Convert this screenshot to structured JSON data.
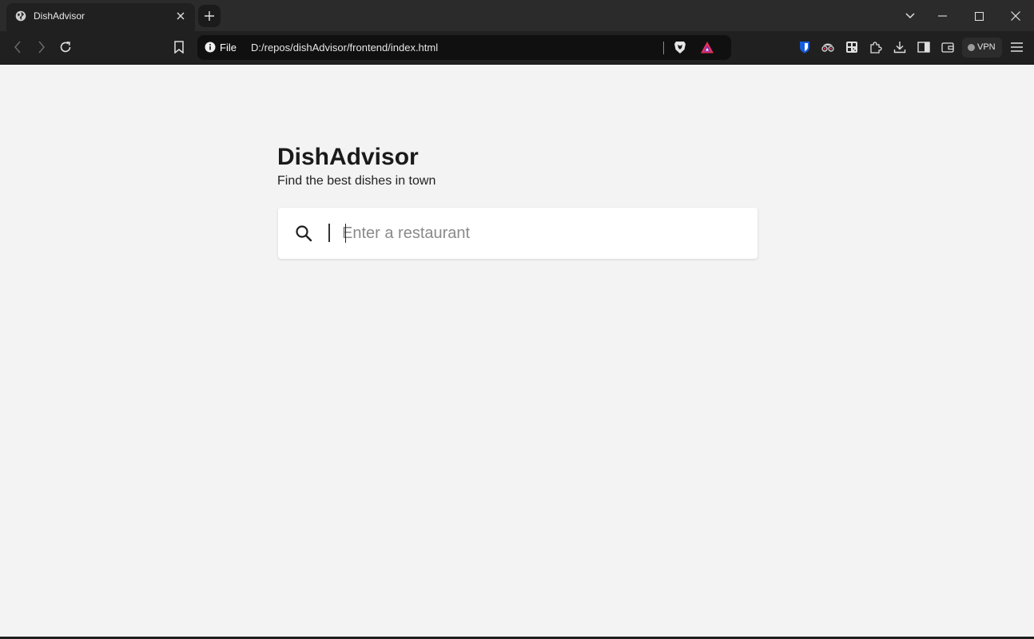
{
  "browser": {
    "tab": {
      "title": "DishAdvisor",
      "favicon": "globe-icon"
    },
    "toolbar": {
      "back": "chevron-left-icon",
      "forward": "chevron-right-icon",
      "reload": "reload-icon",
      "bookmark": "bookmark-icon"
    },
    "address_bar": {
      "scheme_label": "File",
      "url": "D:/repos/dishAdvisor/frontend/index.html"
    },
    "extensions": [
      "bitwarden-icon",
      "spy-glasses-icon",
      "qr-code-icon",
      "puzzle-icon",
      "download-icon",
      "sidebar-icon",
      "wallet-icon"
    ],
    "vpn_label": "VPN",
    "window_controls": [
      "tab-search-icon",
      "minimize-icon",
      "maximize-icon",
      "close-icon"
    ]
  },
  "app": {
    "title": "DishAdvisor",
    "subtitle": "Find the best dishes in town",
    "search": {
      "placeholder": "Enter a restaurant",
      "value": "",
      "icon": "search-icon"
    }
  },
  "colors": {
    "page_background": "#f3f3f3",
    "chrome_background": "#202020",
    "tabstrip_background": "#2b2b2b",
    "omnibox_background": "#101010",
    "brave_orange": "#fb542b",
    "bitwarden_blue": "#175ddc"
  }
}
